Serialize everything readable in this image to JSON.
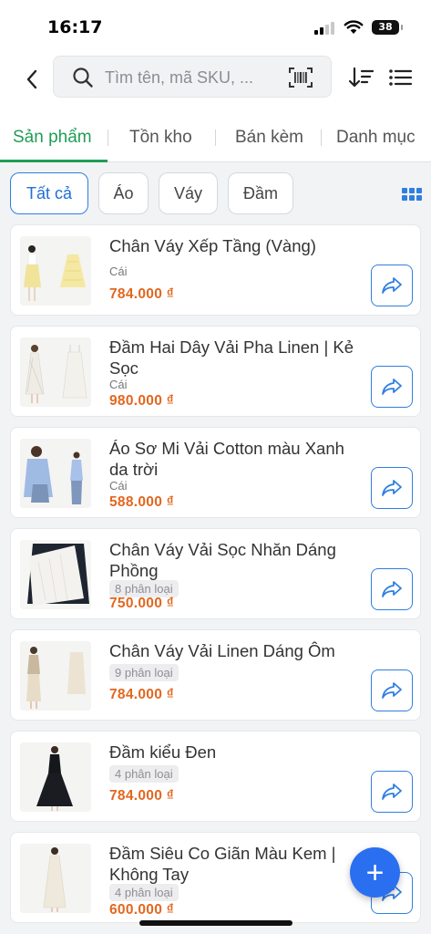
{
  "status_bar": {
    "time": "16:17",
    "battery": "38"
  },
  "search": {
    "placeholder": "Tìm tên, mã SKU, ..."
  },
  "tabs": [
    {
      "label": "Sản phẩm",
      "active": true
    },
    {
      "label": "Tồn kho",
      "active": false
    },
    {
      "label": "Bán kèm",
      "active": false
    },
    {
      "label": "Danh mục",
      "active": false
    }
  ],
  "filters": [
    {
      "label": "Tất cả",
      "active": true
    },
    {
      "label": "Áo",
      "active": false
    },
    {
      "label": "Váy",
      "active": false
    },
    {
      "label": "Đầm",
      "active": false
    }
  ],
  "products": [
    {
      "name": "Chân Váy Xếp Tầng (Vàng)",
      "unit": "Cái",
      "variants": "",
      "price": "784.000 ₫"
    },
    {
      "name": "Đầm Hai Dây Vải Pha Linen | Kẻ Sọc",
      "unit": "Cái",
      "variants": "",
      "price": "980.000 ₫"
    },
    {
      "name": "Áo Sơ Mi Vải Cotton màu Xanh da trời",
      "unit": "Cái",
      "variants": "",
      "price": "588.000 ₫"
    },
    {
      "name": "Chân Váy Vải Sọc Nhăn Dáng Phồng",
      "unit": "",
      "variants": "8 phân loại",
      "price": "750.000 ₫"
    },
    {
      "name": "Chân Váy Vải Linen Dáng Ôm",
      "unit": "",
      "variants": "9 phân loại",
      "price": "784.000 ₫"
    },
    {
      "name": "Đầm kiểu Đen",
      "unit": "",
      "variants": "4 phân loại",
      "price": "784.000 ₫"
    },
    {
      "name": "Đầm Siêu Co Giãn Màu Kem | Không Tay",
      "unit": "",
      "variants": "4 phân loại",
      "price": "600.000 ₫"
    }
  ],
  "fab": {
    "label": "+"
  },
  "colors": {
    "accent_green": "#1f9e55",
    "accent_blue": "#2f7fe0",
    "price_orange": "#e2671f"
  }
}
